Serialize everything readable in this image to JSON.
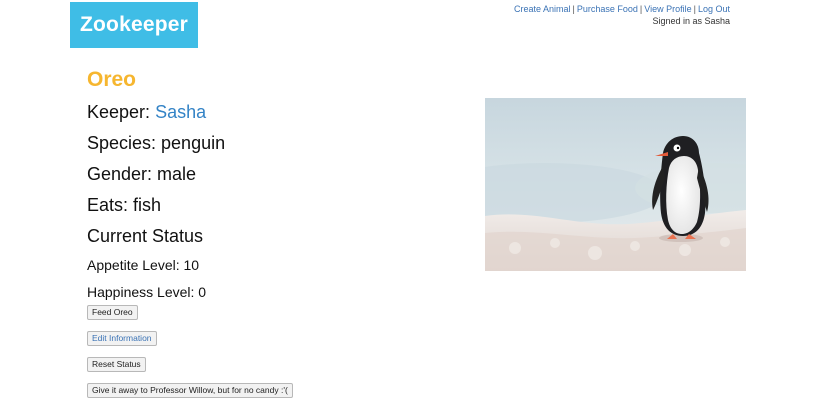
{
  "header": {
    "logo": "Zookeeper",
    "nav": {
      "create_animal": "Create Animal",
      "purchase_food": "Purchase Food",
      "view_profile": "View Profile",
      "log_out": "Log Out",
      "separator": "|"
    },
    "signed_in": "Signed in as Sasha"
  },
  "animal": {
    "name": "Oreo",
    "keeper_label": "Keeper:",
    "keeper_name": "Sasha",
    "species": "Species: penguin",
    "gender": "Gender: male",
    "eats": "Eats: fish",
    "status_heading": "Current Status",
    "appetite": "Appetite Level: 10",
    "happiness": "Happiness Level: 0",
    "photo_icon": "penguin-photo"
  },
  "actions": {
    "feed": "Feed Oreo",
    "edit": "Edit Information",
    "reset": "Reset Status",
    "give_away": "Give it away to Professor Willow, but for no candy :'("
  },
  "colors": {
    "logo_bg": "#3fbde6",
    "animal_name": "#f6b62f",
    "link": "#3383c6"
  }
}
